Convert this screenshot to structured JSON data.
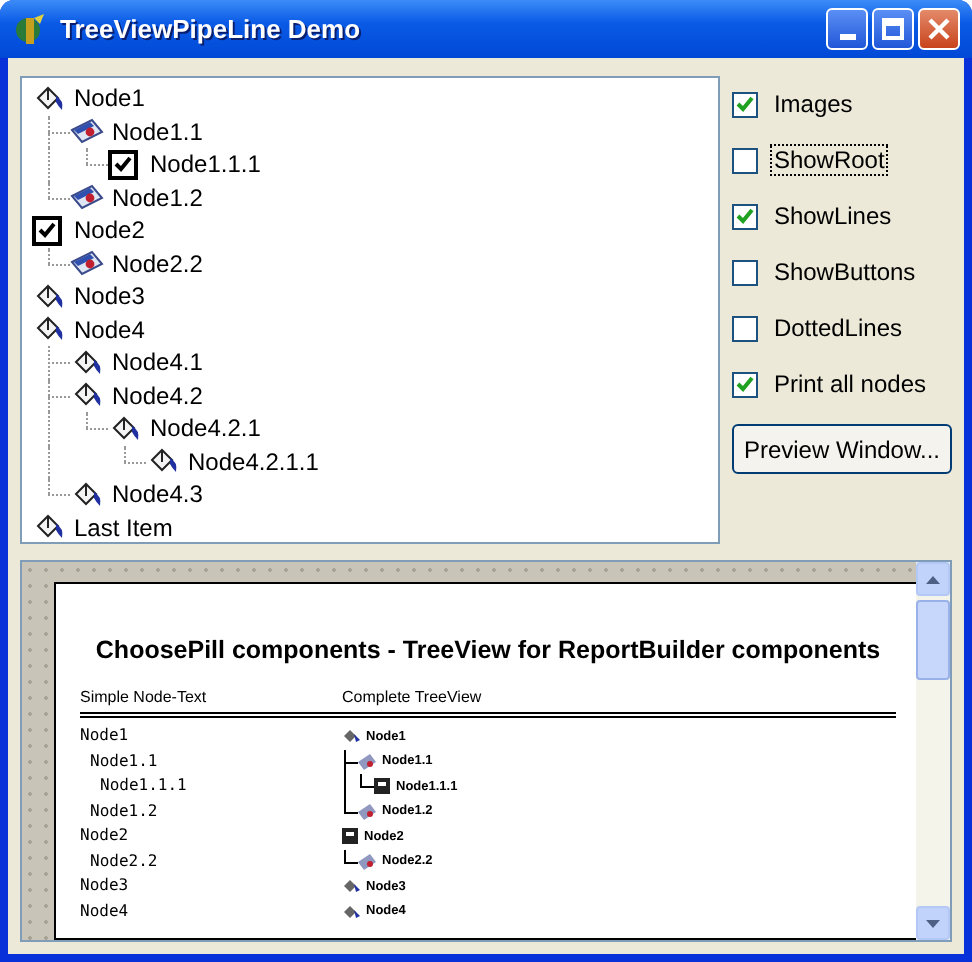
{
  "window": {
    "title": "TreeViewPipeLine Demo"
  },
  "tree": [
    {
      "label": "Node1",
      "kind": "paint",
      "children": [
        {
          "label": "Node1.1",
          "kind": "image",
          "children": [
            {
              "label": "Node1.1.1",
              "kind": "check",
              "checked": true
            }
          ]
        },
        {
          "label": "Node1.2",
          "kind": "image"
        }
      ]
    },
    {
      "label": "Node2",
      "kind": "check",
      "checked": true,
      "children": [
        {
          "label": "Node2.2",
          "kind": "image"
        }
      ]
    },
    {
      "label": "Node3",
      "kind": "paint"
    },
    {
      "label": "Node4",
      "kind": "paint",
      "children": [
        {
          "label": "Node4.1",
          "kind": "paint"
        },
        {
          "label": "Node4.2",
          "kind": "paint",
          "children": [
            {
              "label": "Node4.2.1",
              "kind": "paint",
              "children": [
                {
                  "label": "Node4.2.1.1",
                  "kind": "paint"
                }
              ]
            }
          ]
        },
        {
          "label": "Node4.3",
          "kind": "paint"
        }
      ]
    },
    {
      "label": "Last Item",
      "kind": "paint"
    }
  ],
  "options": [
    {
      "label": "Images",
      "checked": true
    },
    {
      "label": "ShowRoot",
      "checked": false,
      "focused": true
    },
    {
      "label": "ShowLines",
      "checked": true
    },
    {
      "label": "ShowButtons",
      "checked": false
    },
    {
      "label": "DottedLines",
      "checked": false
    },
    {
      "label": "Print all nodes",
      "checked": true
    }
  ],
  "preview_button": "Preview Window...",
  "preview": {
    "title": "ChoosePill components - TreeView for ReportBuilder components",
    "column_1": "Simple Node-Text",
    "column_2": "Complete TreeView",
    "simple_nodes": [
      {
        "label": "Node1",
        "children": [
          {
            "label": "Node1.1",
            "children": [
              {
                "label": "Node1.1.1"
              }
            ]
          },
          {
            "label": "Node1.2"
          }
        ]
      },
      {
        "label": "Node2",
        "children": [
          {
            "label": "Node2.2"
          }
        ]
      },
      {
        "label": "Node3"
      },
      {
        "label": "Node4"
      }
    ],
    "complete_tree": [
      {
        "label": "Node1",
        "kind": "paint",
        "children": [
          {
            "label": "Node1.1",
            "kind": "image",
            "children": [
              {
                "label": "Node1.1.1",
                "kind": "check"
              }
            ]
          },
          {
            "label": "Node1.2",
            "kind": "image"
          }
        ]
      },
      {
        "label": "Node2",
        "kind": "check",
        "children": [
          {
            "label": "Node2.2",
            "kind": "image"
          }
        ]
      },
      {
        "label": "Node3",
        "kind": "paint"
      },
      {
        "label": "Node4",
        "kind": "paint"
      }
    ]
  }
}
